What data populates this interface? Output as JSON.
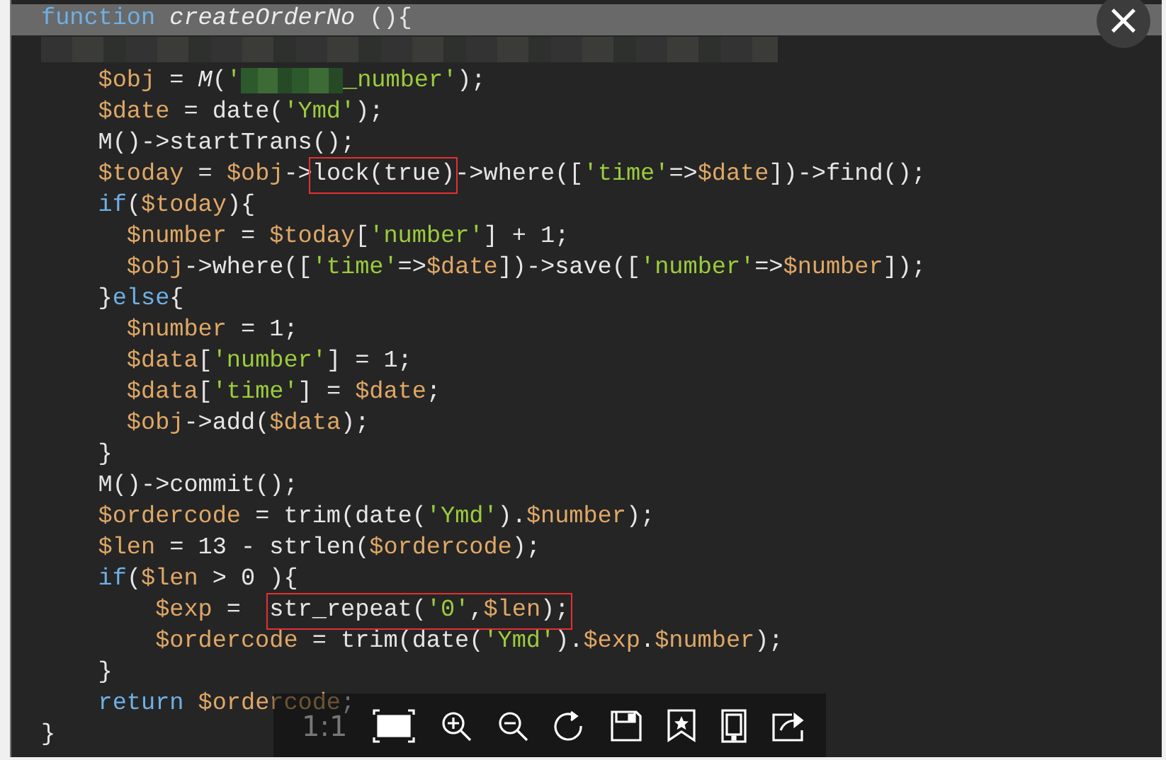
{
  "code_lines": [
    {
      "tokens": [
        {
          "kind": "kw",
          "t": "function "
        },
        {
          "kind": "italic",
          "t": "createOrderNo"
        },
        {
          "kind": "plain",
          "t": " (){"
        }
      ],
      "header": true
    },
    {
      "tokens": [
        {
          "kind": "redacted_line"
        }
      ],
      "header": false
    },
    {
      "tokens": [
        {
          "kind": "var",
          "t": "    $obj"
        },
        {
          "kind": "plain",
          "t": " = "
        },
        {
          "kind": "italic",
          "t": "M"
        },
        {
          "kind": "plain",
          "t": "("
        },
        {
          "kind": "str",
          "t": "'"
        },
        {
          "kind": "redacted_word"
        },
        {
          "kind": "str",
          "t": "_number'"
        },
        {
          "kind": "plain",
          "t": ");"
        }
      ],
      "header": false
    },
    {
      "tokens": [
        {
          "kind": "var",
          "t": "    $date"
        },
        {
          "kind": "plain",
          "t": " = date("
        },
        {
          "kind": "str",
          "t": "'Ymd'"
        },
        {
          "kind": "plain",
          "t": ");"
        }
      ],
      "header": false
    },
    {
      "tokens": [
        {
          "kind": "plain",
          "t": "    M()->startTrans();"
        }
      ],
      "header": false
    },
    {
      "tokens": [
        {
          "kind": "var",
          "t": "    $today"
        },
        {
          "kind": "plain",
          "t": " = "
        },
        {
          "kind": "var",
          "t": "$obj"
        },
        {
          "kind": "plain",
          "t": "->"
        },
        {
          "kind": "plain",
          "t": "lock(true)",
          "boxed": true
        },
        {
          "kind": "plain",
          "t": "->where(["
        },
        {
          "kind": "str",
          "t": "'time'"
        },
        {
          "kind": "plain",
          "t": "=>"
        },
        {
          "kind": "var",
          "t": "$date"
        },
        {
          "kind": "plain",
          "t": "])->find();"
        }
      ],
      "header": false
    },
    {
      "tokens": [
        {
          "kind": "kw",
          "t": "    if"
        },
        {
          "kind": "plain",
          "t": "("
        },
        {
          "kind": "var",
          "t": "$today"
        },
        {
          "kind": "plain",
          "t": "){"
        }
      ],
      "header": false
    },
    {
      "tokens": [
        {
          "kind": "var",
          "t": "      $number"
        },
        {
          "kind": "plain",
          "t": " = "
        },
        {
          "kind": "var",
          "t": "$today"
        },
        {
          "kind": "plain",
          "t": "["
        },
        {
          "kind": "str",
          "t": "'number'"
        },
        {
          "kind": "plain",
          "t": "] + 1;"
        }
      ],
      "header": false
    },
    {
      "tokens": [
        {
          "kind": "var",
          "t": "      $obj"
        },
        {
          "kind": "plain",
          "t": "->where(["
        },
        {
          "kind": "str",
          "t": "'time'"
        },
        {
          "kind": "plain",
          "t": "=>"
        },
        {
          "kind": "var",
          "t": "$date"
        },
        {
          "kind": "plain",
          "t": "])->save(["
        },
        {
          "kind": "str",
          "t": "'number'"
        },
        {
          "kind": "plain",
          "t": "=>"
        },
        {
          "kind": "var",
          "t": "$number"
        },
        {
          "kind": "plain",
          "t": "]);"
        }
      ],
      "header": false
    },
    {
      "tokens": [
        {
          "kind": "plain",
          "t": "    }"
        },
        {
          "kind": "kw",
          "t": "else"
        },
        {
          "kind": "plain",
          "t": "{"
        }
      ],
      "header": false
    },
    {
      "tokens": [
        {
          "kind": "var",
          "t": "      $number"
        },
        {
          "kind": "plain",
          "t": " = 1;"
        }
      ],
      "header": false
    },
    {
      "tokens": [
        {
          "kind": "var",
          "t": "      $data"
        },
        {
          "kind": "plain",
          "t": "["
        },
        {
          "kind": "str",
          "t": "'number'"
        },
        {
          "kind": "plain",
          "t": "] = 1;"
        }
      ],
      "header": false
    },
    {
      "tokens": [
        {
          "kind": "var",
          "t": "      $data"
        },
        {
          "kind": "plain",
          "t": "["
        },
        {
          "kind": "str",
          "t": "'time'"
        },
        {
          "kind": "plain",
          "t": "] = "
        },
        {
          "kind": "var",
          "t": "$date"
        },
        {
          "kind": "plain",
          "t": ";"
        }
      ],
      "header": false
    },
    {
      "tokens": [
        {
          "kind": "var",
          "t": "      $obj"
        },
        {
          "kind": "plain",
          "t": "->add("
        },
        {
          "kind": "var",
          "t": "$data"
        },
        {
          "kind": "plain",
          "t": ");"
        }
      ],
      "header": false
    },
    {
      "tokens": [
        {
          "kind": "plain",
          "t": "    }"
        }
      ],
      "header": false
    },
    {
      "tokens": [
        {
          "kind": "plain",
          "t": "    M()->commit();"
        }
      ],
      "header": false
    },
    {
      "tokens": [
        {
          "kind": "var",
          "t": "    $ordercode"
        },
        {
          "kind": "plain",
          "t": " = trim(date("
        },
        {
          "kind": "str",
          "t": "'Ymd'"
        },
        {
          "kind": "plain",
          "t": ")."
        },
        {
          "kind": "var",
          "t": "$number"
        },
        {
          "kind": "plain",
          "t": ");"
        }
      ],
      "header": false
    },
    {
      "tokens": [
        {
          "kind": "var",
          "t": "    $len"
        },
        {
          "kind": "plain",
          "t": " = 13 - strlen("
        },
        {
          "kind": "var",
          "t": "$ordercode"
        },
        {
          "kind": "plain",
          "t": ");"
        }
      ],
      "header": false
    },
    {
      "tokens": [
        {
          "kind": "kw",
          "t": "    if"
        },
        {
          "kind": "plain",
          "t": "("
        },
        {
          "kind": "var",
          "t": "$len"
        },
        {
          "kind": "plain",
          "t": " > 0 ){"
        }
      ],
      "header": false
    },
    {
      "tokens": [
        {
          "kind": "var",
          "t": "        $exp"
        },
        {
          "kind": "plain",
          "t": " =  "
        },
        {
          "kind": "plain",
          "t": "str_repeat(",
          "boxed": true
        },
        {
          "kind": "str",
          "t": "'0'",
          "boxed": true
        },
        {
          "kind": "plain",
          "t": ",",
          "boxed": true
        },
        {
          "kind": "var",
          "t": "$len",
          "boxed": true
        },
        {
          "kind": "plain",
          "t": ");",
          "boxed": true
        }
      ],
      "header": false
    },
    {
      "tokens": [
        {
          "kind": "var",
          "t": "        $ordercode"
        },
        {
          "kind": "plain",
          "t": " = trim(date("
        },
        {
          "kind": "str",
          "t": "'Ymd'"
        },
        {
          "kind": "plain",
          "t": ")."
        },
        {
          "kind": "var",
          "t": "$exp"
        },
        {
          "kind": "plain",
          "t": "."
        },
        {
          "kind": "var",
          "t": "$number"
        },
        {
          "kind": "plain",
          "t": ");"
        }
      ],
      "header": false
    },
    {
      "tokens": [
        {
          "kind": "plain",
          "t": "    }"
        }
      ],
      "header": false
    },
    {
      "tokens": [
        {
          "kind": "kw",
          "t": "    return "
        },
        {
          "kind": "var",
          "t": "$ordercode"
        },
        {
          "kind": "plain",
          "t": ";"
        }
      ],
      "header": false
    },
    {
      "tokens": [
        {
          "kind": "plain",
          "t": "}"
        }
      ],
      "header": false
    }
  ],
  "close_button": {
    "label": "×"
  },
  "toolbar": {
    "ratio_label": "1:1"
  }
}
